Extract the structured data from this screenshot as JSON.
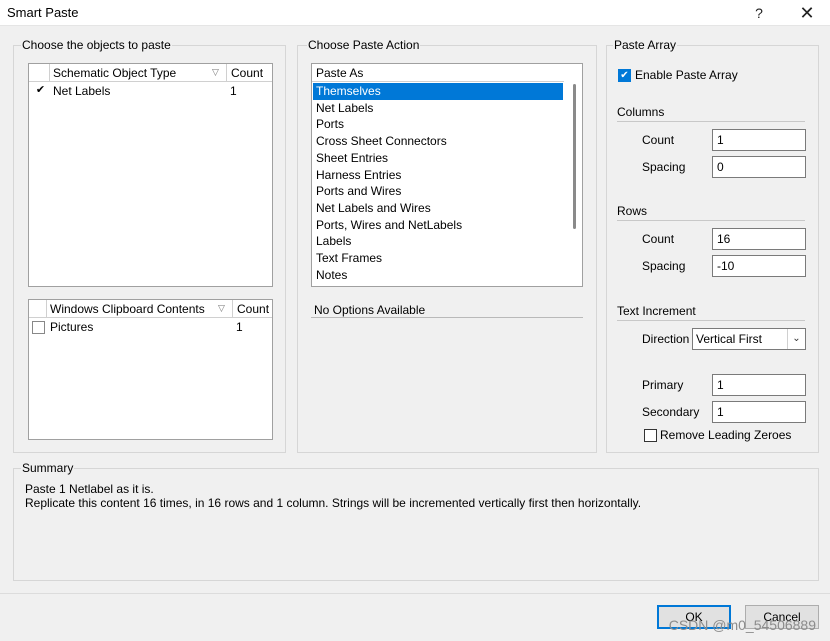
{
  "window": {
    "title": "Smart Paste",
    "help_glyph": "?",
    "close_glyph": "✕"
  },
  "objects": {
    "group_title": "Choose the objects to paste",
    "schematic": {
      "col_type": "Schematic Object Type",
      "col_count": "Count",
      "rows": [
        {
          "checked": true,
          "check_glyph": "✔",
          "label": "Net Labels",
          "count": "1"
        }
      ]
    },
    "clipboard": {
      "col_type": "Windows Clipboard Contents",
      "col_count": "Count",
      "rows": [
        {
          "checked": false,
          "check_glyph": "",
          "label": "Pictures",
          "count": "1"
        }
      ]
    }
  },
  "action": {
    "group_title": "Choose Paste Action",
    "paste_as_header": "Paste As",
    "items": [
      "Themselves",
      "Net Labels",
      "Ports",
      "Cross Sheet Connectors",
      "Sheet Entries",
      "Harness Entries",
      "Ports and Wires",
      "Net Labels and Wires",
      "Ports, Wires and NetLabels",
      "Labels",
      "Text Frames",
      "Notes"
    ],
    "selected_index": 0,
    "options_text": "No Options Available"
  },
  "array": {
    "group_title": "Paste Array",
    "enable_label": "Enable Paste Array",
    "enable_checked": true,
    "enable_glyph": "✔",
    "columns": {
      "title": "Columns",
      "count_label": "Count",
      "count_value": "1",
      "spacing_label": "Spacing",
      "spacing_value": "0"
    },
    "rows": {
      "title": "Rows",
      "count_label": "Count",
      "count_value": "16",
      "spacing_label": "Spacing",
      "spacing_value": "-10"
    },
    "increment": {
      "title": "Text Increment",
      "direction_label": "Direction",
      "direction_value": "Vertical First",
      "primary_label": "Primary",
      "primary_value": "1",
      "secondary_label": "Secondary",
      "secondary_value": "1",
      "remove_zeroes_label": "Remove Leading Zeroes",
      "remove_zeroes_checked": false
    }
  },
  "summary": {
    "title": "Summary",
    "line1": "Paste 1 Netlabel as it is.",
    "line2": "Replicate this content 16 times, in 16 rows and 1 column. Strings will be incremented vertically first then horizontally."
  },
  "buttons": {
    "ok": "OK",
    "cancel": "Cancel"
  },
  "watermark": "CSDN @m0_54506889",
  "colors": {
    "selection": "#0078d7",
    "checkbox_checked": "#0078d7"
  },
  "icons": {
    "sort": "sort-filter-icon",
    "dropdown": "chevron-down-icon",
    "checkmark": "checkmark-icon"
  }
}
